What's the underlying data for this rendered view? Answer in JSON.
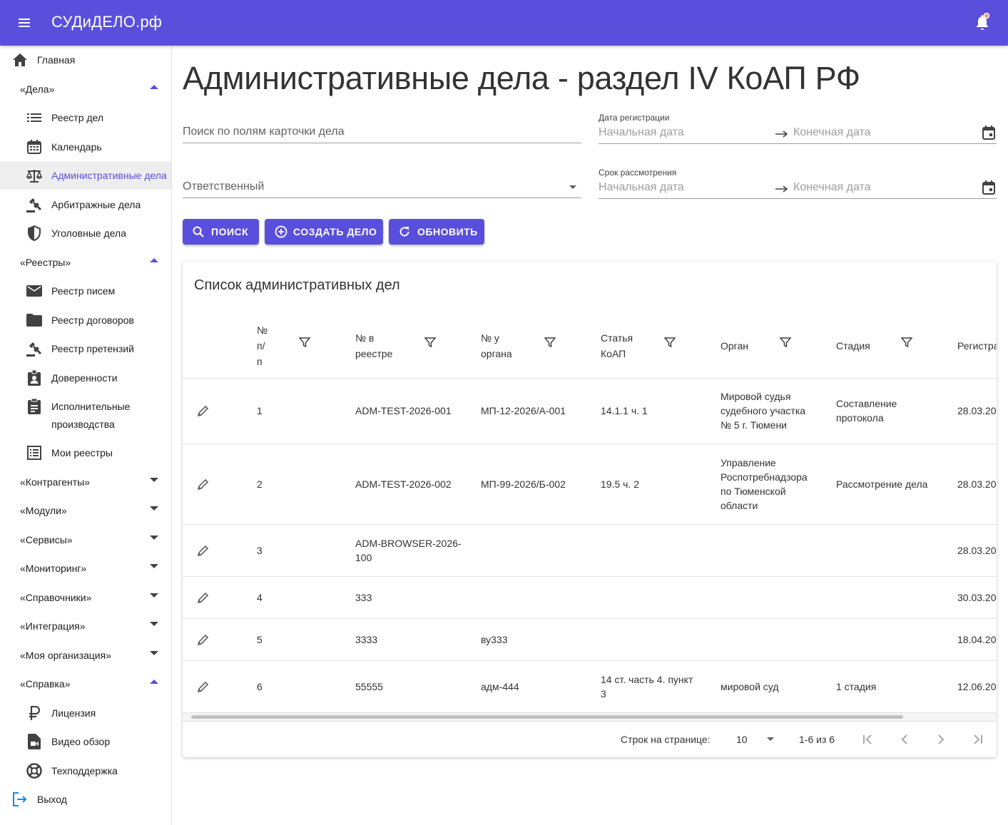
{
  "app": {
    "title": "СУДиДЕЛО.рф"
  },
  "icons": {
    "menu": "menu-icon",
    "notifications": "bell-icon"
  },
  "sidebar": {
    "home": "Главная",
    "cases_group": "«Дела»",
    "cases_items": [
      "Реестр дел",
      "Календарь",
      "Административные дела",
      "Арбитражные дела",
      "Уголовные дела"
    ],
    "registries_group": "«Реестры»",
    "registries_items": [
      "Реестр писем",
      "Реестр договоров",
      "Реестр претензий",
      "Доверенности",
      "Исполнительные",
      "производства",
      "Мои реестры"
    ],
    "groups": [
      "«Контрагенты»",
      "«Модули»",
      "«Сервисы»",
      "«Мониторинг»",
      "«Справочники»",
      "«Интеграция»",
      "«Моя организация»"
    ],
    "help_group": "«Справка»",
    "help_items": [
      "Лицензия",
      "Видео обзор",
      "Техподдержка"
    ],
    "logout": "Выход"
  },
  "page": {
    "title": "Административные дела - раздел IV КоАП РФ"
  },
  "filters": {
    "search_placeholder": "Поиск по полям карточки дела",
    "responsible_placeholder": "Ответственный",
    "reg_date_label": "Дата регистрации",
    "review_date_label": "Срок рассмотрения",
    "start_placeholder": "Начальная дата",
    "end_placeholder": "Конечная дата"
  },
  "buttons": {
    "search": "ПОИСК",
    "create": "СОЗДАТЬ ДЕЛО",
    "refresh": "ОБНОВИТЬ"
  },
  "table": {
    "title": "Список административных дел",
    "headers": {
      "num_1": "№",
      "num_2": "п/",
      "num_3": "п",
      "reg_1": "№ в",
      "reg_2": "реестре",
      "org_num_1": "№ у",
      "org_num_2": "органа",
      "article_1": "Статья",
      "article_2": "КоАП",
      "organ": "Орган",
      "stage": "Стадия",
      "registration": "Регистра"
    },
    "rows": [
      {
        "n": "1",
        "reg": "ADM-TEST-2026-001",
        "org_num": "МП-12-2026/А-001",
        "article": "14.1.1 ч. 1",
        "organ_1": "Мировой судья",
        "organ_2": "судебного участка",
        "organ_3": "№ 5 г. Тюмени",
        "stage_1": "Составление",
        "stage_2": "протокола",
        "date": "28.03.20"
      },
      {
        "n": "2",
        "reg": "ADM-TEST-2026-002",
        "org_num": "МП-99-2026/Б-002",
        "article": "19.5 ч. 2",
        "organ_1": "Управление",
        "organ_2": "Роспотребнадзора",
        "organ_3": "по Тюменской",
        "organ_4": "области",
        "stage": "Рассмотрение дела",
        "date": "28.03.20"
      },
      {
        "n": "3",
        "reg_1": "ADM-BROWSER-2026-",
        "reg_2": "100",
        "date": "28.03.20"
      },
      {
        "n": "4",
        "reg": "333",
        "date": "30.03.20"
      },
      {
        "n": "5",
        "reg": "3333",
        "org_num": "ву333",
        "date": "18.04.20"
      },
      {
        "n": "6",
        "reg": "55555",
        "org_num": "адм-444",
        "article_1": "14 ст. часть 4. пункт",
        "article_2": "3",
        "organ": "мировой суд",
        "stage": "1 стадия",
        "date": "12.06.20"
      }
    ],
    "pagination": {
      "rows_per_page_label": "Строк на странице:",
      "rows_per_page": "10",
      "range": "1-6 из 6"
    }
  },
  "colors": {
    "primary": "#5a4fdc",
    "active_bg": "#eeeeee"
  }
}
